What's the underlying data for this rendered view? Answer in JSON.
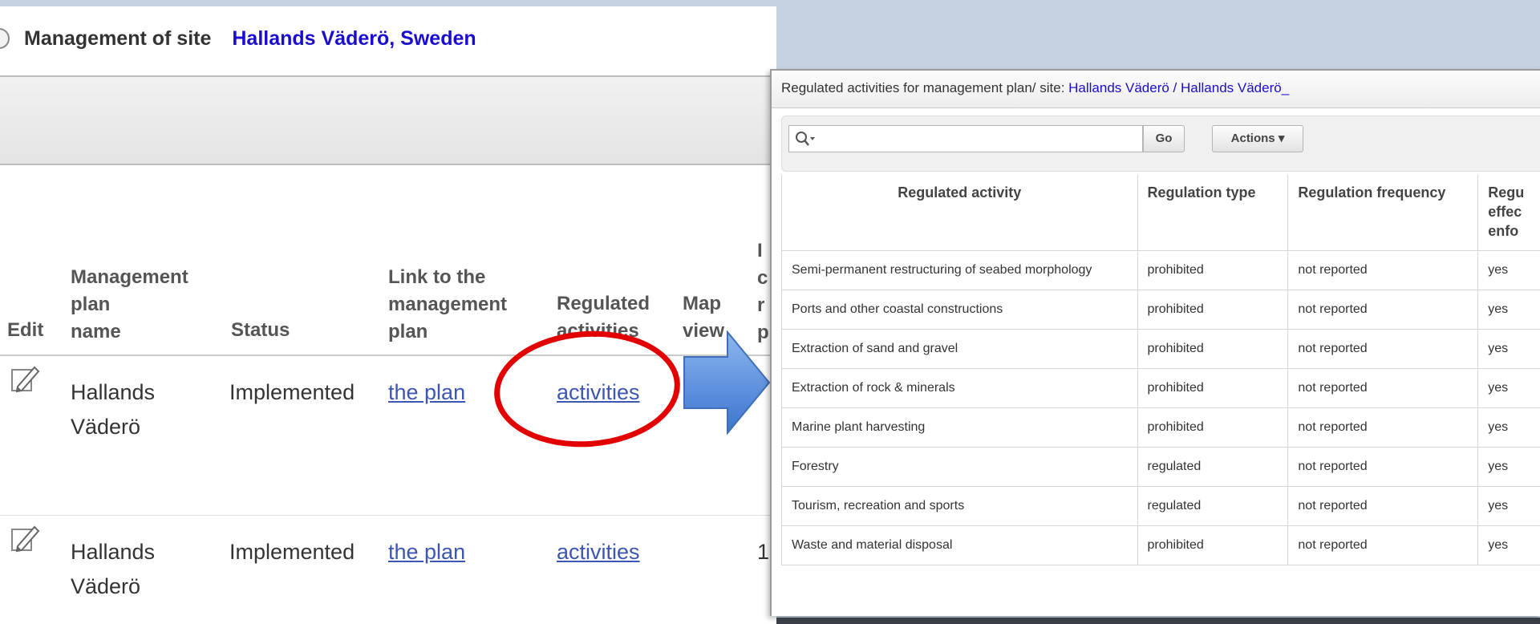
{
  "site_header": {
    "label": "Management of site",
    "site_name": "Hallands Väderö, Sweden"
  },
  "plans_table": {
    "headers": {
      "edit": "Edit",
      "name": [
        "Management",
        "plan",
        "name"
      ],
      "status": "Status",
      "link": [
        "Link to the",
        "management",
        "plan"
      ],
      "regulated": [
        "Regulated",
        "activities"
      ],
      "map": [
        "Map",
        "view"
      ],
      "partial": [
        "I",
        "c",
        "r",
        "p"
      ]
    },
    "rows": [
      {
        "name_line1": "Hallands",
        "name_line2": "Väderö",
        "status": "Implemented",
        "plan_link": "the plan",
        "activities_link": "activities",
        "partial": ""
      },
      {
        "name_line1": "Hallands",
        "name_line2": "Väderö",
        "status": "Implemented",
        "plan_link": "the plan",
        "activities_link": "activities",
        "partial": "1"
      }
    ]
  },
  "dialog": {
    "title_prefix": "Regulated activities for management plan/ site: ",
    "title_site": "Hallands Väderö / Hallands Väderö_",
    "search_placeholder": "",
    "go_label": "Go",
    "actions_label": "Actions ▾",
    "columns": [
      "Regulated activity",
      "Regulation type",
      "Regulation frequency",
      "Regu\neffec\nenfo"
    ],
    "rows": [
      [
        "Semi-permanent restructuring of seabed morphology",
        "prohibited",
        "not reported",
        "yes"
      ],
      [
        "Ports and other coastal constructions",
        "prohibited",
        "not reported",
        "yes"
      ],
      [
        "Extraction of sand and gravel",
        "prohibited",
        "not reported",
        "yes"
      ],
      [
        "Extraction of rock & minerals",
        "prohibited",
        "not reported",
        "yes"
      ],
      [
        "Marine plant harvesting",
        "prohibited",
        "not reported",
        "yes"
      ],
      [
        "Forestry",
        "regulated",
        "not reported",
        "yes"
      ],
      [
        "Tourism, recreation and sports",
        "regulated",
        "not reported",
        "yes"
      ],
      [
        "Waste and material disposal",
        "prohibited",
        "not reported",
        "yes"
      ]
    ]
  }
}
